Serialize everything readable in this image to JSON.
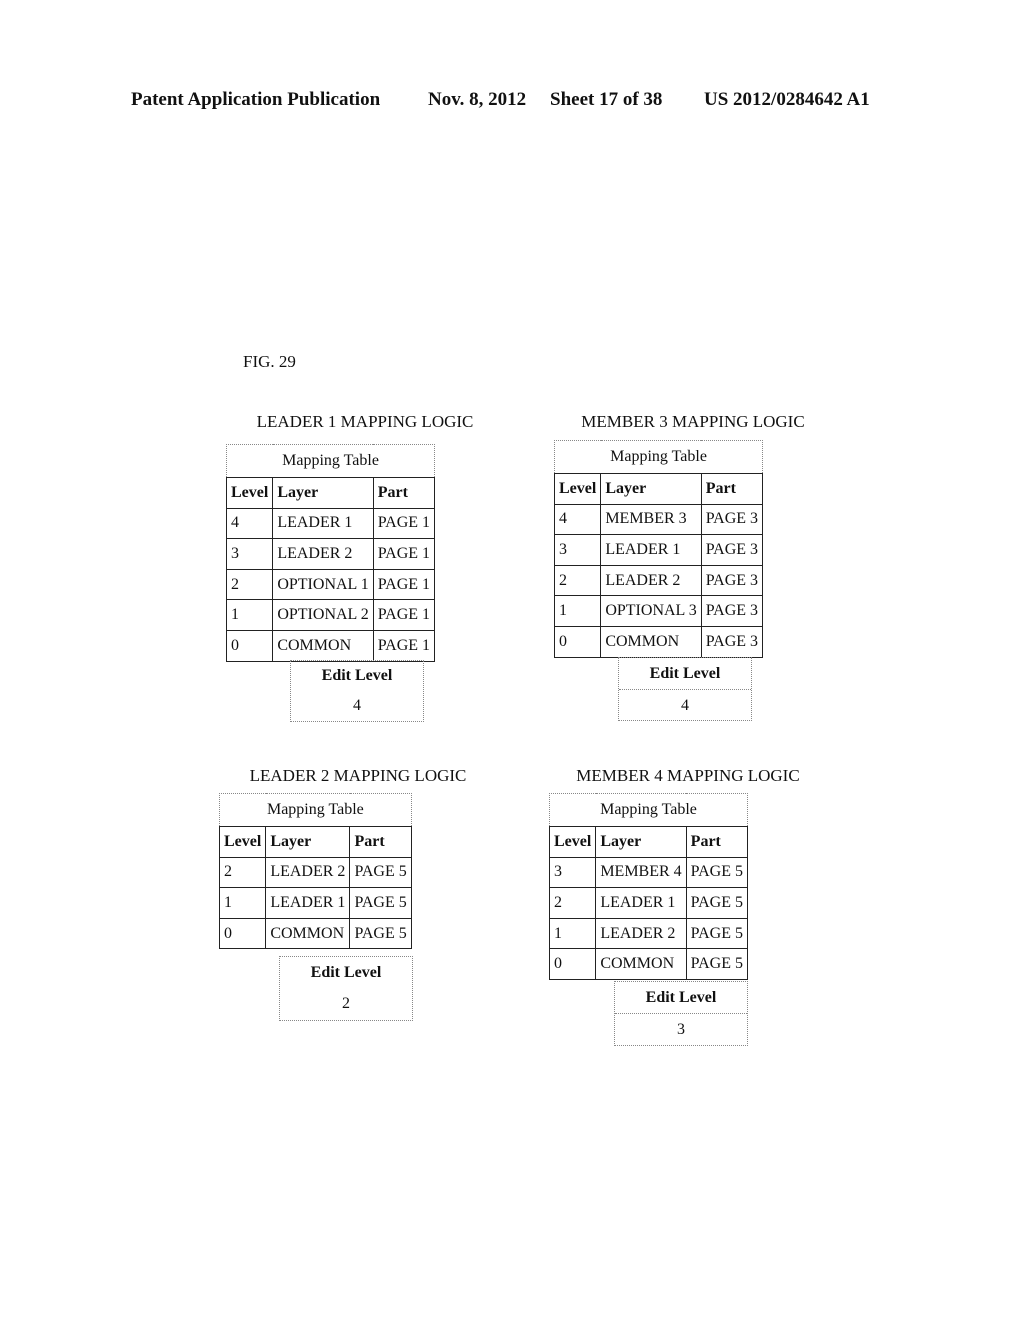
{
  "header": {
    "publication": "Patent Application Publication",
    "date": "Nov. 8, 2012",
    "sheet": "Sheet 17 of 38",
    "number": "US 2012/0284642 A1"
  },
  "figure_label": "FIG. 29",
  "blocks": [
    {
      "title": "LEADER 1 MAPPING LOGIC",
      "table_caption": "Mapping Table",
      "columns": [
        "Level",
        "Layer",
        "Part"
      ],
      "rows": [
        [
          "4",
          "LEADER 1",
          "PAGE 1"
        ],
        [
          "3",
          "LEADER 2",
          "PAGE 1"
        ],
        [
          "2",
          "OPTIONAL 1",
          "PAGE 1"
        ],
        [
          "1",
          "OPTIONAL 2",
          "PAGE 1"
        ],
        [
          "0",
          "COMMON",
          "PAGE 1"
        ]
      ],
      "edit_label": "Edit Level",
      "edit_value": "4"
    },
    {
      "title": "MEMBER 3 MAPPING LOGIC",
      "table_caption": "Mapping Table",
      "columns": [
        "Level",
        "Layer",
        "Part"
      ],
      "rows": [
        [
          "4",
          "MEMBER 3",
          "PAGE 3"
        ],
        [
          "3",
          "LEADER 1",
          "PAGE 3"
        ],
        [
          "2",
          "LEADER 2",
          "PAGE 3"
        ],
        [
          "1",
          "OPTIONAL 3",
          "PAGE 3"
        ],
        [
          "0",
          "COMMON",
          "PAGE 3"
        ]
      ],
      "edit_label": "Edit Level",
      "edit_value": "4"
    },
    {
      "title": "LEADER 2 MAPPING LOGIC",
      "table_caption": "Mapping Table",
      "columns": [
        "Level",
        "Layer",
        "Part"
      ],
      "rows": [
        [
          "2",
          "LEADER 2",
          "PAGE 5"
        ],
        [
          "1",
          "LEADER 1",
          "PAGE 5"
        ],
        [
          "0",
          "COMMON",
          "PAGE 5"
        ]
      ],
      "edit_label": "Edit Level",
      "edit_value": "2"
    },
    {
      "title": "MEMBER 4 MAPPING LOGIC",
      "table_caption": "Mapping Table",
      "columns": [
        "Level",
        "Layer",
        "Part"
      ],
      "rows": [
        [
          "3",
          "MEMBER 4",
          "PAGE 5"
        ],
        [
          "2",
          "LEADER 1",
          "PAGE 5"
        ],
        [
          "1",
          "LEADER 2",
          "PAGE 5"
        ],
        [
          "0",
          "COMMON",
          "PAGE 5"
        ]
      ],
      "edit_label": "Edit Level",
      "edit_value": "3"
    }
  ]
}
